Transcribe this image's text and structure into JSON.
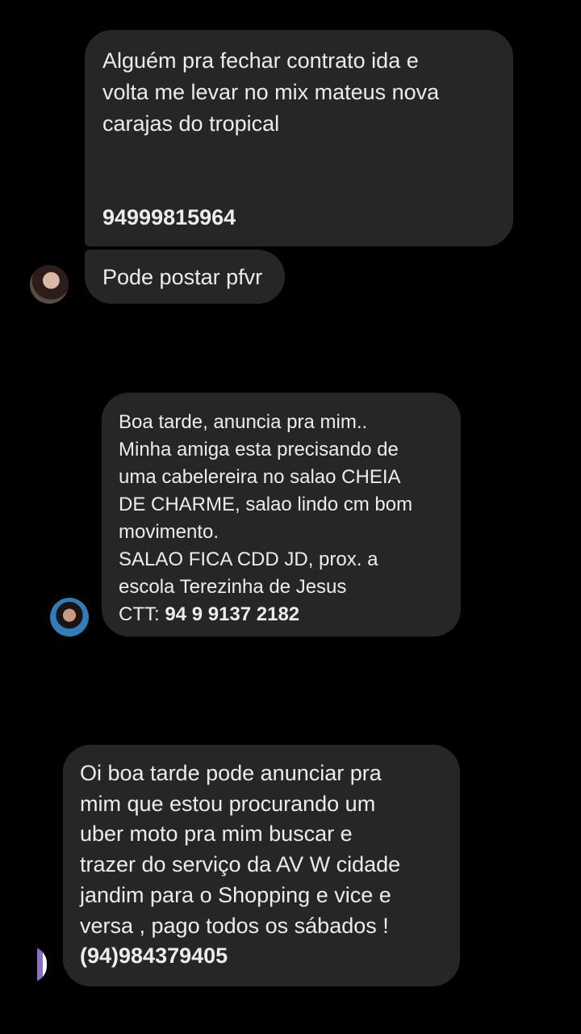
{
  "messages": [
    {
      "lines": [
        "Alguém pra fechar contrato ida e",
        "volta me levar no mix mateus nova",
        "carajas do tropical"
      ],
      "phone": "94999815964"
    },
    {
      "lines": [
        "Pode postar pfvr"
      ]
    },
    {
      "lines": [
        "Boa tarde, anuncia pra mim..",
        "Minha amiga esta precisando de",
        "uma cabelereira no salao CHEIA",
        "DE CHARME, salao lindo cm bom",
        "movimento.",
        "SALAO FICA CDD JD, prox. a",
        "escola Terezinha de Jesus"
      ],
      "contact_label": "CTT: ",
      "phone": "94 9 9137 2182"
    },
    {
      "lines": [
        "Oi boa tarde pode anunciar pra",
        "mim que estou procurando um",
        "uber moto pra mim buscar e",
        "trazer do serviço da AV W cidade",
        "jandim para o Shopping e vice e",
        "versa , pago todos os sábados !"
      ],
      "phone": "(94)984379405"
    }
  ],
  "colors": {
    "background": "#000000",
    "bubble": "#262626",
    "text": "#ececec"
  },
  "icons": [
    "avatar-woman-dark-hair",
    "avatar-woman-blue-background",
    "avatar-partial-purple"
  ]
}
